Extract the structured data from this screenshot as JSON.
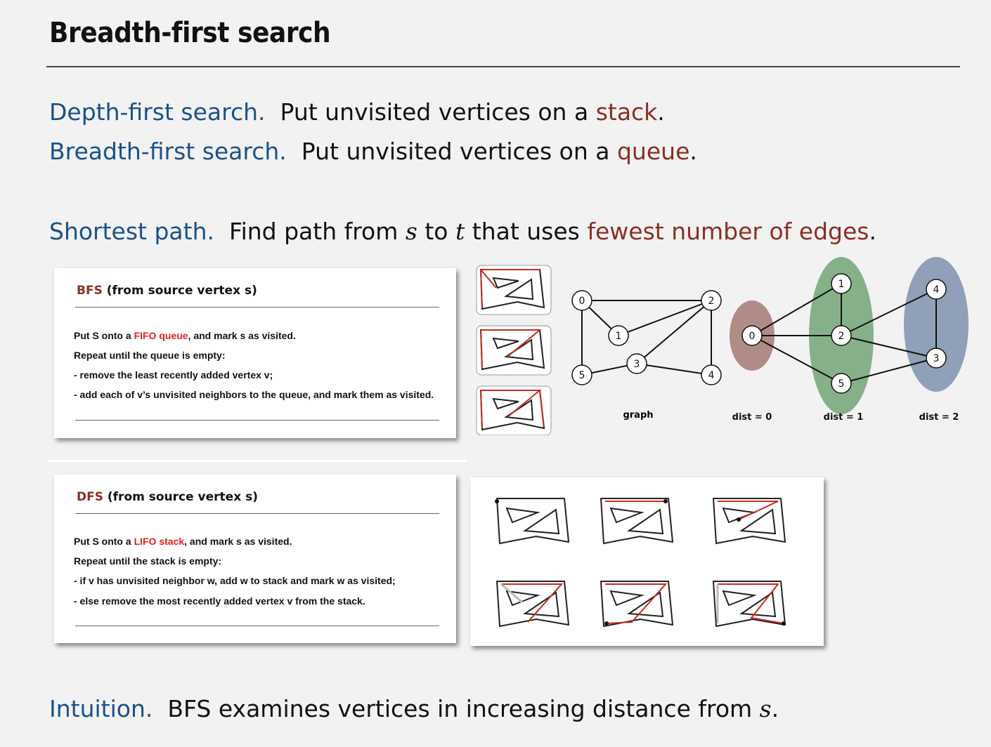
{
  "title": "Breadth-first search",
  "dfs_line": {
    "label": "Depth-first search.",
    "text": "Put unvisited vertices on a",
    "keyword": "stack",
    "end": "."
  },
  "bfs_line": {
    "label": "Breadth-first search.",
    "text": "Put unvisited vertices on a",
    "keyword": "queue",
    "end": "."
  },
  "shortest": {
    "label": "Shortest path.",
    "t1": "Find path from",
    "s": "s",
    "t2": "to",
    "t": "t",
    "t3": "that uses",
    "keyword": "fewest number of edges",
    "end": "."
  },
  "bfs_card": {
    "kw": "BFS",
    "head": "(from source vertex s)",
    "s1a": "Put S onto a ",
    "s1hl": "FIFO queue",
    "s1b": ", and mark s as visited.",
    "s2": "Repeat until the queue is empty:",
    "s3": "- remove the least recently added vertex v;",
    "s4": "- add each of v’s unvisited neighbors to the queue, and mark them as visited."
  },
  "dfs_card": {
    "kw": "DFS",
    "head": "(from source vertex s)",
    "s1a": "Put S onto a ",
    "s1hl": "LIFO stack",
    "s1b": ", and mark s as visited.",
    "s2": "Repeat until the stack is empty:",
    "s3": "- if v has unvisited neighbor w, add w to stack and mark w as visited;",
    "s4": "- else remove the most recently added vertex v from the stack."
  },
  "graph": {
    "caption": "graph",
    "vertices": [
      "0",
      "1",
      "2",
      "3",
      "4",
      "5"
    ]
  },
  "levels": {
    "d0": "dist = 0",
    "d1": "dist = 1",
    "d2": "dist = 2",
    "colors": {
      "d0": "#b08c86",
      "d1": "#86b08a",
      "d2": "#8fa0b8"
    }
  },
  "intuition": {
    "label": "Intuition.",
    "text": "BFS examines vertices in increasing distance from",
    "s": "s",
    "end": "."
  }
}
